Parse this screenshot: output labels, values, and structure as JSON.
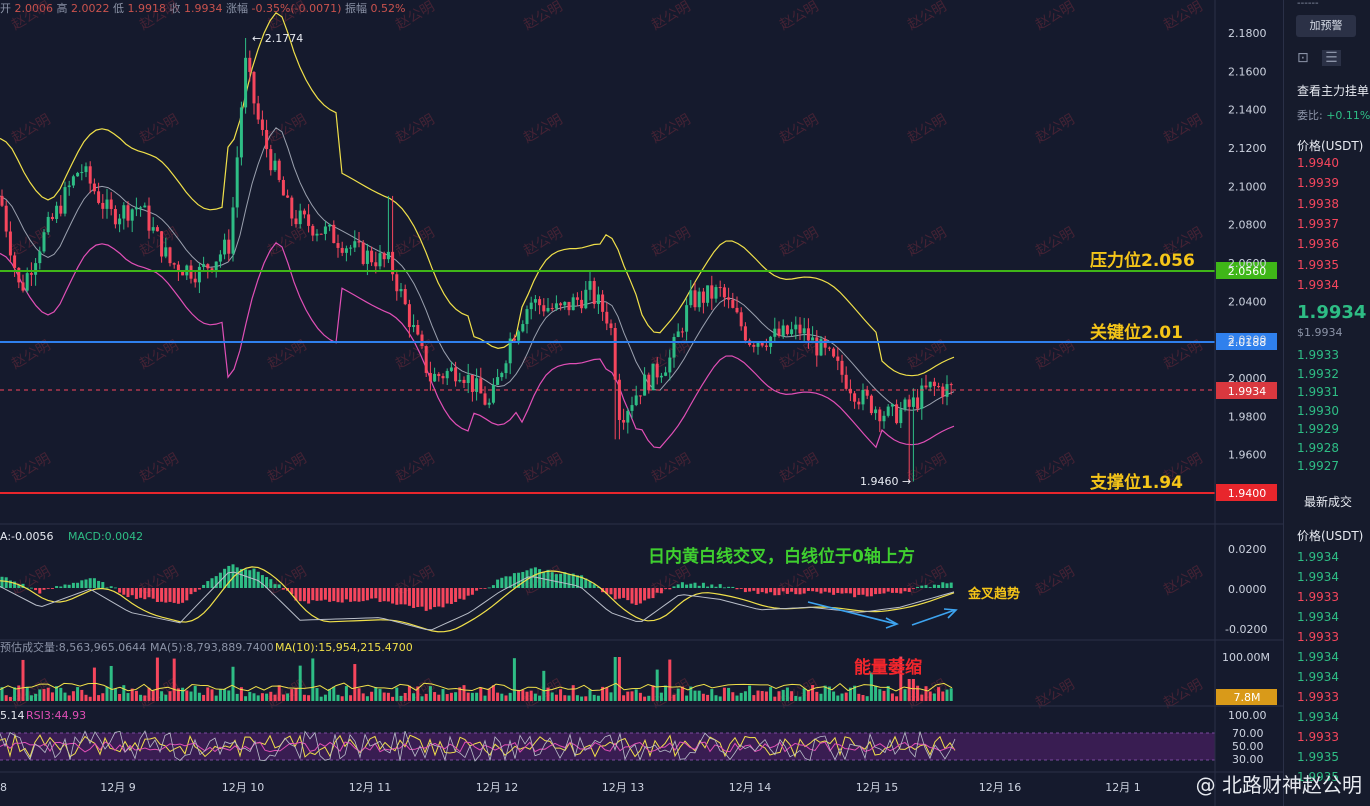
{
  "ohlc_bar": {
    "open_label": "开",
    "open": "2.0006",
    "high_label": "高",
    "high": "2.0022",
    "low_label": "低",
    "low": "1.9918",
    "close_label": "收",
    "close": "1.9934",
    "change_label": "涨幅",
    "change": "-0.35%(-0.0071)",
    "amp_label": "振幅",
    "amp": "0.52%"
  },
  "colors": {
    "up": "#2ebd85",
    "down": "#f6465d",
    "resistance": "#3fb618",
    "key": "#2f80ed",
    "support": "#e8262c",
    "boll_upper": "#f0e04a",
    "boll_mid": "#9aa0ae",
    "boll_lower": "#e04fb6"
  },
  "chart_data": [
    {
      "type": "candlestick",
      "x_ticks": [
        "12月 9",
        "12月 10",
        "12月 11",
        "12月 12",
        "12月 13",
        "12月 14",
        "12月 15",
        "12月 16",
        "12月 1"
      ],
      "first_tick_partial": "8",
      "y_ticks": [
        "2.1800",
        "2.1600",
        "2.1400",
        "2.1200",
        "2.1000",
        "2.0800",
        "2.0600",
        "2.0400",
        "2.0200",
        "2.0000",
        "1.9800",
        "1.9600"
      ],
      "ylim": [
        1.94,
        2.18
      ],
      "high_marker": "← 2.1774",
      "low_marker": "1.9460 →",
      "last_price": "1.9934",
      "levels": [
        {
          "name": "压力位2.056",
          "value": 2.056,
          "tag": "2.0560",
          "color": "#3fb618"
        },
        {
          "name": "关键位2.01",
          "value": 2.0188,
          "tag": "2.0188",
          "color": "#2f80ed"
        },
        {
          "name": "支撑位1.94",
          "value": 1.94,
          "tag": "1.9400",
          "color": "#e8262c"
        }
      ],
      "overlays": [
        "BOLL upper",
        "BOLL mid",
        "BOLL lower"
      ],
      "watermark": "赵公明"
    },
    {
      "type": "bar",
      "name": "MACD",
      "label_dif": "A:-0.0056",
      "label_macd": "MACD:0.0042",
      "y_ticks": [
        "0.0200",
        "0.0000",
        "-0.0200"
      ],
      "annotation": "日内黄白线交叉，白线位于0轴上方",
      "annotation2": "金叉趋势"
    },
    {
      "type": "bar",
      "name": "Volume",
      "label_est": "预估成交量:8,563,965.0644",
      "label_ma5": "MA(5):8,793,889.7400",
      "label_ma10": "MA(10):15,954,215.4700",
      "y_ticks": [
        "100.00M"
      ],
      "last_tag": "7.8M",
      "annotation": "能量萎缩"
    },
    {
      "type": "line",
      "name": "RSI",
      "label_a": "5.14",
      "label_b": "RSI3:44.93",
      "y_ticks": [
        "100.00",
        "70.00",
        "50.00",
        "30.00"
      ]
    }
  ],
  "right_panel": {
    "alert_button": "加预警",
    "view_label": "查看主力挂单",
    "ratio_label": "委比:",
    "ratio_value": "+0.11%",
    "price_header": "价格(USDT)",
    "asks": [
      "1.9940",
      "1.9939",
      "1.9938",
      "1.9937",
      "1.9936",
      "1.9935",
      "1.9934"
    ],
    "mid_price": "1.9934",
    "mid_sub": "$1.9934",
    "bids": [
      "1.9933",
      "1.9932",
      "1.9931",
      "1.9930",
      "1.9929",
      "1.9928",
      "1.9927"
    ],
    "trades_title": "最新成交",
    "trades_header": "价格(USDT)",
    "trades": [
      {
        "p": "1.9934",
        "s": "up"
      },
      {
        "p": "1.9934",
        "s": "up"
      },
      {
        "p": "1.9933",
        "s": "down"
      },
      {
        "p": "1.9934",
        "s": "up"
      },
      {
        "p": "1.9933",
        "s": "down"
      },
      {
        "p": "1.9934",
        "s": "up"
      },
      {
        "p": "1.9934",
        "s": "up"
      },
      {
        "p": "1.9933",
        "s": "down"
      },
      {
        "p": "1.9934",
        "s": "up"
      },
      {
        "p": "1.9933",
        "s": "down"
      },
      {
        "p": "1.9935",
        "s": "up"
      },
      {
        "p": "1.9935",
        "s": "up"
      }
    ]
  },
  "footer_watermark": "@ 北路财神赵公明"
}
